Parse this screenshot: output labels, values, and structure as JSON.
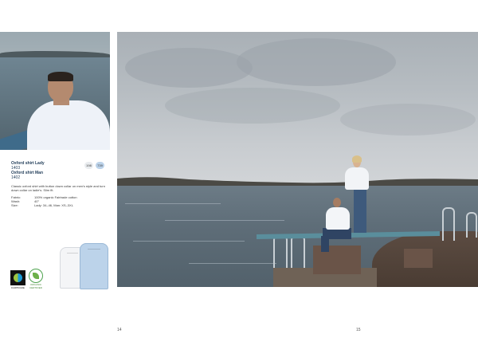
{
  "product": {
    "name_lady": "Oxford shirt Lady",
    "code_lady": "1403",
    "name_man": "Oxford shirt Man",
    "code_man": "1402",
    "description": "Classic oxford shirt with button down collar on men's style and turn down collar on ladie's. Slim fit.",
    "colors": [
      {
        "code": "198",
        "hex": "#e9ecef"
      },
      {
        "code": "739",
        "hex": "#bcd3ea"
      }
    ],
    "specs": [
      {
        "key": "Fabric:",
        "value": "100% organic Fairtrade cotton"
      },
      {
        "key": "Wash:",
        "value": "40°"
      },
      {
        "key": "Size:",
        "value": "Lady: 34–46, Man: XS–3XL"
      }
    ]
  },
  "badges": {
    "fairtrade_label": "FAIRTRADE",
    "organic_label": "ORGANIC CERTIFIED"
  },
  "pages": {
    "left": "14",
    "right": "15"
  }
}
